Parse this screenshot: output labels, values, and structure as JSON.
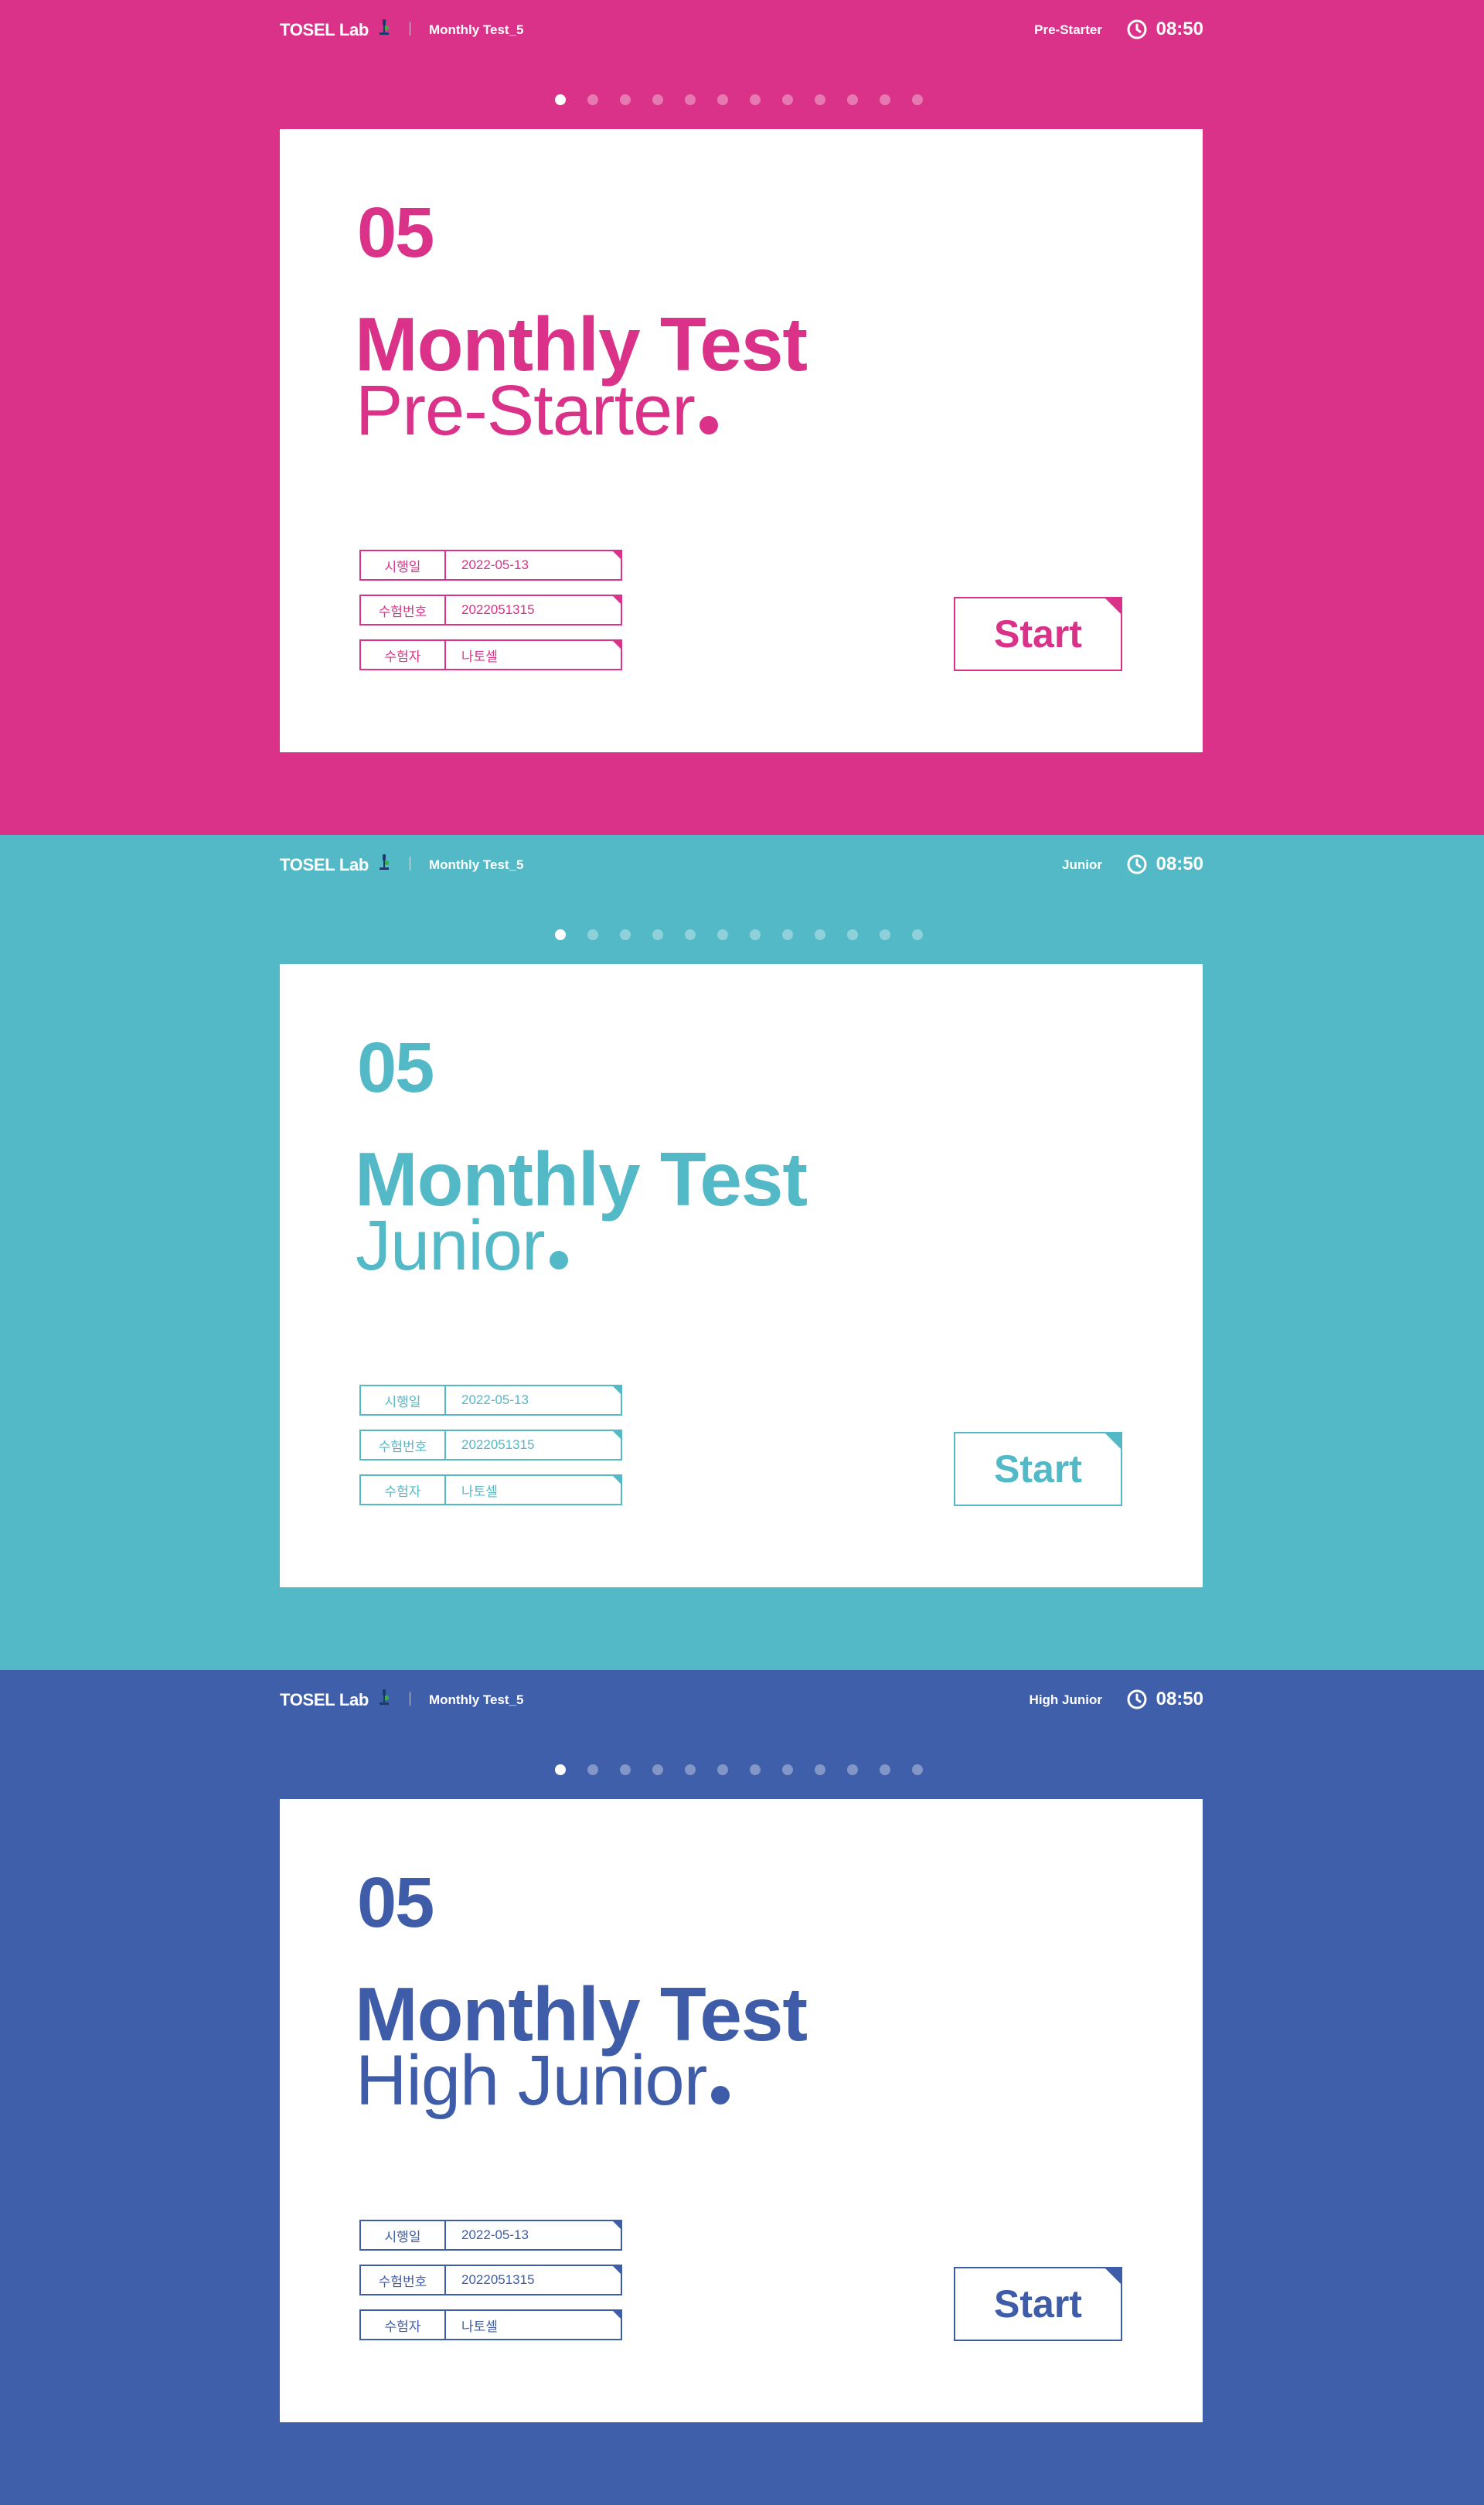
{
  "panels": [
    {
      "bg": "#DB3289",
      "accent": "#DB3289",
      "header": {
        "brand": "TOSEL Lab",
        "test_name": "Monthly Test_5",
        "level": "Pre-Starter",
        "time": "08:50"
      },
      "card": {
        "number": "05",
        "title": "Monthly Test",
        "level": "Pre-Starter",
        "info": [
          {
            "label": "시행일",
            "value": "2022-05-13"
          },
          {
            "label": "수험번호",
            "value": "2022051315"
          },
          {
            "label": "수험자",
            "value": "나토셀"
          }
        ],
        "start_label": "Start"
      }
    },
    {
      "bg": "#53B9C7",
      "accent": "#53B9C7",
      "header": {
        "brand": "TOSEL Lab",
        "test_name": "Monthly Test_5",
        "level": "Junior",
        "time": "08:50"
      },
      "card": {
        "number": "05",
        "title": "Monthly Test",
        "level": "Junior",
        "info": [
          {
            "label": "시행일",
            "value": "2022-05-13"
          },
          {
            "label": "수험번호",
            "value": "2022051315"
          },
          {
            "label": "수험자",
            "value": "나토셀"
          }
        ],
        "start_label": "Start"
      }
    },
    {
      "bg": "#405FAB",
      "accent": "#3F5CA8",
      "header": {
        "brand": "TOSEL Lab",
        "test_name": "Monthly Test_5",
        "level": "High Junior",
        "time": "08:50"
      },
      "card": {
        "number": "05",
        "title": "Monthly Test",
        "level": "High Junior",
        "info": [
          {
            "label": "시행일",
            "value": "2022-05-13"
          },
          {
            "label": "수험번호",
            "value": "2022051315"
          },
          {
            "label": "수험자",
            "value": "나토셀"
          }
        ],
        "start_label": "Start"
      }
    }
  ],
  "pagination": {
    "total": 12,
    "active_index": 0
  },
  "icons": {
    "brand": "microscope-icon",
    "timer": "clock-icon"
  }
}
